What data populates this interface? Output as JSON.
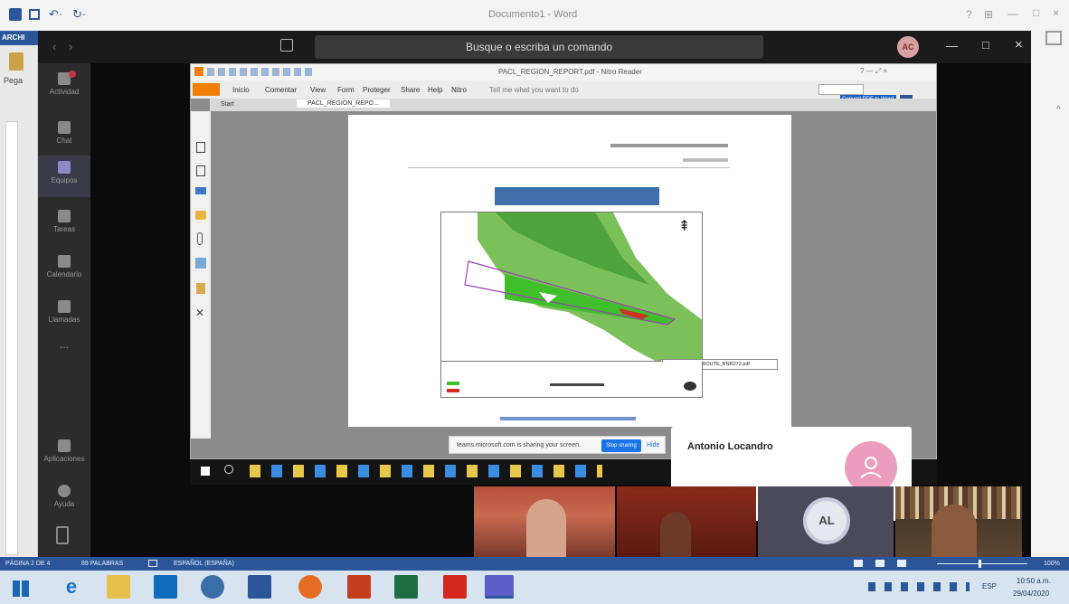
{
  "word": {
    "title": "Documento1 - Word",
    "status_page": "PÁGINA 2 DE 4",
    "status_words": "89 PALABRAS",
    "status_lang": "ESPAÑOL (ESPAÑA)",
    "zoom": "100%",
    "left_label_top": "ARCHI",
    "left_label_side": "Pega"
  },
  "teams": {
    "search_placeholder": "Busque o escriba un comando",
    "user_initials": "AC",
    "rail": [
      {
        "label": "Actividad"
      },
      {
        "label": "Chat"
      },
      {
        "label": "Equipos"
      },
      {
        "label": "Tareas"
      },
      {
        "label": "Calendario"
      },
      {
        "label": "Llamadas"
      },
      {
        "label": "..."
      },
      {
        "label": "Aplicaciones"
      },
      {
        "label": "Ayuda"
      }
    ]
  },
  "pdf": {
    "title": "PACL_REGION_REPORT.pdf - Nitro Reader",
    "ribbon_tabs": [
      "Inicio",
      "Comentar",
      "View",
      "Form",
      "Proteger",
      "Share",
      "Help",
      "Nitro"
    ],
    "ribbon_hint": "Tell me what you want to do",
    "tab_start": "Start",
    "tab_doc": "PACL_REGION_REPO...",
    "badge": "Convert PDF to Word",
    "filename_tag": "PACL_TAXOFF_ROUTE_RNR272.pdf"
  },
  "share_bar": {
    "text": "teams.microsoft.com is sharing your screen.",
    "button": "Stop sharing",
    "hide": "Hide"
  },
  "participant": {
    "name": "Antonio Locandro",
    "initials": "AL"
  },
  "taskbar": {
    "time": "10:50 a.m.",
    "date": "29/04/2020",
    "lang": "ESP"
  },
  "colors": {
    "teams_purple": "#464775",
    "word_blue": "#2b579a",
    "avatar_pink": "#ec9cbc",
    "map_green": "#3fbf2a"
  }
}
